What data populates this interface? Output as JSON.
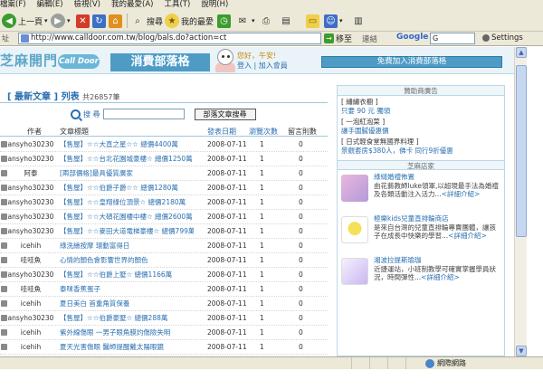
{
  "menu": [
    "檔案(F)",
    "編輯(E)",
    "檢視(V)",
    "我的最愛(A)",
    "工具(T)",
    "說明(H)"
  ],
  "toolbar": {
    "back_label": "上一頁",
    "search_label": "搜尋",
    "favorites_label": "我的最愛"
  },
  "address": {
    "label": "址",
    "url": "http://www.calldoor.com.tw/blog/bals.do?action=ct",
    "go_label": "移至",
    "links_label": "連結",
    "google_label": "Google",
    "google_input": "G",
    "settings_label": "Settings"
  },
  "banner": {
    "logo_text": "芝麻開門",
    "logo_badge": "Call Door",
    "site_section": "消費部落格",
    "greeting": "您好，午安!",
    "login_links": "登入 | 加入會員",
    "join_button": "免費加入消費部落格"
  },
  "main": {
    "section_title": "[ 最新文章 ] 列表",
    "count": "共26857筆",
    "search_label": "搜 尋",
    "search_button": "部落文章搜尋",
    "headers": {
      "author": "作者",
      "title": "文章標題",
      "date": "發表日期",
      "views": "瀏覽次數",
      "comments": "留言則數"
    },
    "rows": [
      {
        "author": "ansyho30230",
        "title": "【售屋】☆☆大直之星☆☆ 總價4400萬",
        "date": "2008-07-11",
        "views": "1",
        "comments": "0"
      },
      {
        "author": "ansyho30230",
        "title": "【售屋】☆☆台北花園城豪樓☆ 總價1250萬",
        "date": "2008-07-11",
        "views": "1",
        "comments": "0"
      },
      {
        "author": "阿泰",
        "title": "[兩部價格]最具優質廣家",
        "date": "2008-07-11",
        "views": "1",
        "comments": "0"
      },
      {
        "author": "ansyho30230",
        "title": "【售屋】☆☆伯爵子爵☆☆ 總價1280萬",
        "date": "2008-07-11",
        "views": "1",
        "comments": "0"
      },
      {
        "author": "ansyho30230",
        "title": "【售屋】☆☆皇翔綠位頂景☆ 總價2180萬",
        "date": "2008-07-11",
        "views": "1",
        "comments": "0"
      },
      {
        "author": "ansyho30230",
        "title": "【售屋】☆☆大碩花園樓中樓☆ 總價2600萬",
        "date": "2008-07-11",
        "views": "1",
        "comments": "0"
      },
      {
        "author": "ansyho30230",
        "title": "【售屋】☆☆麥田大道電梯豪樓☆ 總價799萬",
        "date": "2008-07-11",
        "views": "1",
        "comments": "0"
      },
      {
        "author": "icehih",
        "title": "綠洗繪按摩 環動富得日",
        "date": "2008-07-11",
        "views": "1",
        "comments": "0"
      },
      {
        "author": "哇哇魚",
        "title": "心情的顏色會影響世界的顏色",
        "date": "2008-07-11",
        "views": "1",
        "comments": "0"
      },
      {
        "author": "ansyho30230",
        "title": "【售屋】☆☆伯爵上墅☆ 總價1166萬",
        "date": "2008-07-11",
        "views": "1",
        "comments": "0"
      },
      {
        "author": "哇哇魚",
        "title": "泰咪香蕉蛋子",
        "date": "2008-07-11",
        "views": "1",
        "comments": "0"
      },
      {
        "author": "icehih",
        "title": "夏日美白 首重角質保養",
        "date": "2008-07-11",
        "views": "1",
        "comments": "0"
      },
      {
        "author": "ansyho30230",
        "title": "【售屋】☆☆伯爵豪墅☆ 總價288萬",
        "date": "2008-07-11",
        "views": "1",
        "comments": "0"
      },
      {
        "author": "icehih",
        "title": "紫外線傷眼 一男子眼角膜灼傷險失明",
        "date": "2008-07-11",
        "views": "1",
        "comments": "0"
      },
      {
        "author": "icehih",
        "title": "夏天光害傷眼 醫師提醒戴太陽眼鏡",
        "date": "2008-07-11",
        "views": "1",
        "comments": "0"
      }
    ]
  },
  "sidebar": {
    "ads_title": "贊助商廣告",
    "ads": [
      {
        "title": "[ 繡繡衣櫥 ]",
        "desc": "只要 90 元 獨領"
      },
      {
        "title": "[ 一泡紅泡菜 ]",
        "desc": "讓手圍膩優惠價"
      },
      {
        "title": "[ 日式輕食堂無國界料理 ]",
        "desc": "景觀套房$380人，佛卡 同行9折優惠"
      }
    ],
    "stores_title": "芝麻店家",
    "stores": [
      {
        "name": "綠縫婚禮佈置",
        "desc": "由花藝教師luke領軍,以超現最手法為婚禮及各類活動注入活力...",
        "more": "<詳細介紹>"
      },
      {
        "name": "極樂kids兒童直排輪商店",
        "desc": "是來自台灣的兒童直排輪專賣團體，讓孩子在成長中快樂的學習...",
        "more": "<詳細介紹>"
      },
      {
        "name": "湘波拉提斯瑜珈",
        "desc": "近捷運站，小班制教學可確實掌握學員狀況，時間彈性...",
        "more": "<詳細介紹>"
      }
    ]
  },
  "status": {
    "zone": "網際網路"
  },
  "colors": {
    "accent_blue": "#2a6fb0",
    "banner_blue": "#4e9cc6",
    "chrome": "#ece9d8"
  }
}
